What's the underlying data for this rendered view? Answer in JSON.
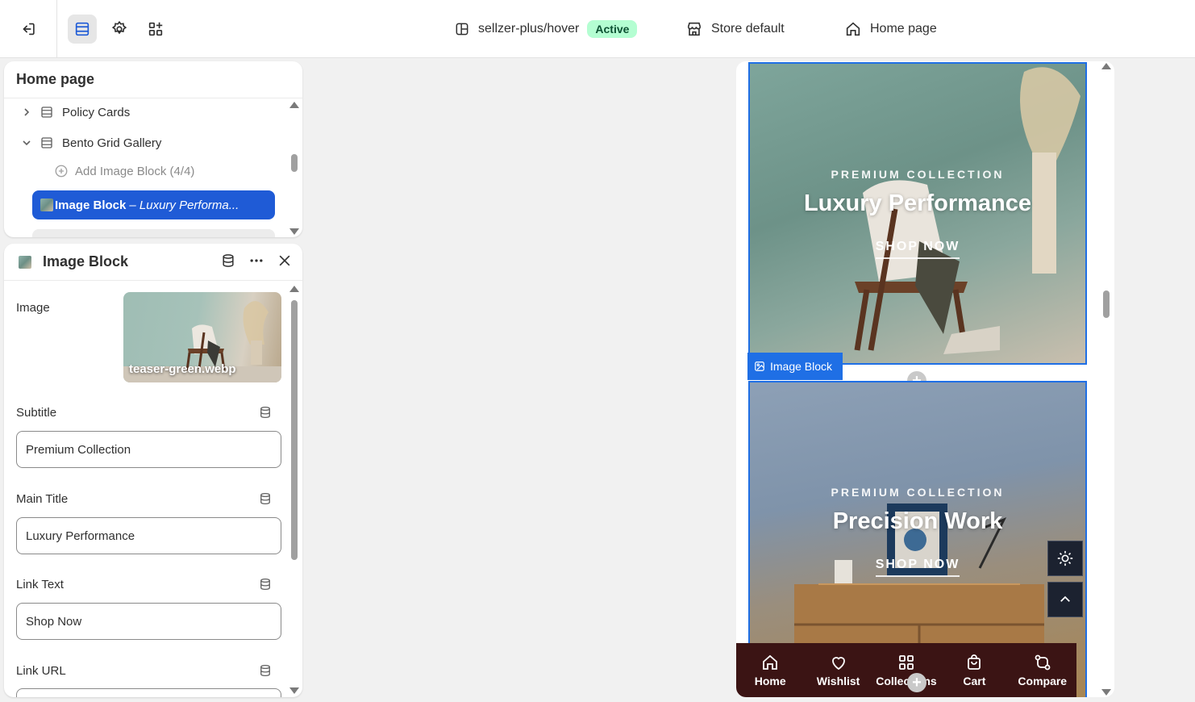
{
  "topbar": {
    "theme_name": "sellzer-plus/hover",
    "status_badge": "Active",
    "store": "Store default",
    "page": "Home page"
  },
  "tree_panel": {
    "title": "Home page",
    "items": [
      {
        "label": "Policy Cards"
      },
      {
        "label": "Bento Grid Gallery"
      },
      {
        "label": "Add Image Block (4/4)"
      }
    ],
    "selected": {
      "label": "Image Block",
      "detail": "– Luxury Performa..."
    }
  },
  "block_panel": {
    "title": "Image Block",
    "image_label": "Image",
    "image_filename": "teaser-green.webp",
    "fields": [
      {
        "label": "Subtitle",
        "value": "Premium Collection"
      },
      {
        "label": "Main Title",
        "value": "Luxury Performance"
      },
      {
        "label": "Link Text",
        "value": "Shop Now"
      },
      {
        "label": "Link URL",
        "value": ""
      }
    ]
  },
  "preview": {
    "cards": [
      {
        "subtitle": "PREMIUM COLLECTION",
        "title": "Luxury Performance",
        "link": "SHOP NOW"
      },
      {
        "subtitle": "PREMIUM COLLECTION",
        "title": "Precision Work",
        "link": "SHOP NOW"
      }
    ],
    "block_tag": "Image Block",
    "nav": [
      {
        "label": "Home",
        "icon": "home-icon"
      },
      {
        "label": "Wishlist",
        "icon": "heart-icon"
      },
      {
        "label": "Collections",
        "icon": "grid-icon"
      },
      {
        "label": "Cart",
        "icon": "bag-icon"
      },
      {
        "label": "Compare",
        "icon": "compare-icon"
      }
    ]
  },
  "colors": {
    "accent": "#1f5bd6",
    "preview_selection": "#1f6fe5",
    "active_badge_bg": "#b4fed2",
    "mobile_nav_bg": "#3b1414"
  }
}
